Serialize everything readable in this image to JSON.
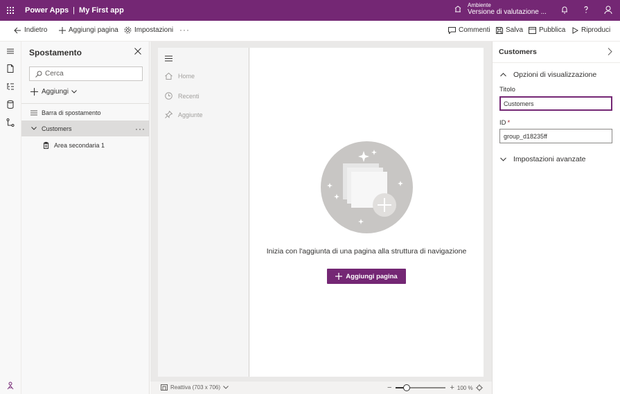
{
  "app": {
    "product": "Power Apps",
    "separator": "|",
    "app_name": "My First app",
    "environment_label": "Ambiente",
    "environment_name": "Versione di valutazione ..."
  },
  "command_bar": {
    "back": "Indietro",
    "add_page": "Aggiungi pagina",
    "settings": "Impostazioni",
    "more": "···",
    "comments": "Commenti",
    "save": "Salva",
    "publish": "Pubblica",
    "play": "Riproduci"
  },
  "tree": {
    "title": "Spostamento",
    "search_placeholder": "Cerca",
    "add_menu": "Aggiungi",
    "items": [
      {
        "label": "Barra di spostamento"
      },
      {
        "label": "Customers",
        "more": "···"
      },
      {
        "label": "Area secondaria 1"
      }
    ]
  },
  "preview": {
    "nav_items": [
      {
        "label": "Home"
      },
      {
        "label": "Recenti"
      },
      {
        "label": "Aggiunte"
      }
    ],
    "empty_message": "Inizia con l'aggiunta di una pagina alla struttura di navigazione",
    "add_page_button": "Aggiungi pagina"
  },
  "status_bar": {
    "layout": "Reattiva (703 x 706)",
    "zoom_minus": "−",
    "zoom_plus": "+",
    "zoom_value": "100 %",
    "zoom_level_percent": 100
  },
  "properties": {
    "title": "Customers",
    "display_section": "Opzioni di visualizzazione",
    "title_label": "Titolo",
    "title_value": "Customers",
    "id_label": "ID",
    "id_required": "*",
    "id_value": "group_d18235ff",
    "advanced_section": "Impostazioni avanzate"
  },
  "colors": {
    "brand": "#742774",
    "required": "#a4262c"
  }
}
